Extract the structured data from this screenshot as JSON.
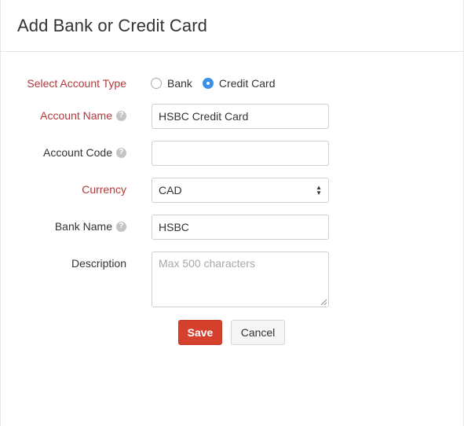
{
  "dialog": {
    "title": "Add Bank or Credit Card"
  },
  "form": {
    "account_type": {
      "label": "Select Account Type",
      "options": [
        {
          "label": "Bank",
          "checked": false
        },
        {
          "label": "Credit Card",
          "checked": true
        }
      ]
    },
    "account_name": {
      "label": "Account Name",
      "value": "HSBC Credit Card"
    },
    "account_code": {
      "label": "Account Code",
      "value": ""
    },
    "currency": {
      "label": "Currency",
      "value": "CAD"
    },
    "bank_name": {
      "label": "Bank Name",
      "value": "HSBC"
    },
    "description": {
      "label": "Description",
      "placeholder": "Max 500 characters",
      "value": ""
    }
  },
  "actions": {
    "save_label": "Save",
    "cancel_label": "Cancel"
  },
  "colors": {
    "required_label": "#b3383a",
    "save_button": "#d5402d",
    "radio_checked": "#3b8fe8"
  },
  "icons": {
    "help": "help-icon",
    "select_arrows": "chevron-up-down-icon"
  }
}
